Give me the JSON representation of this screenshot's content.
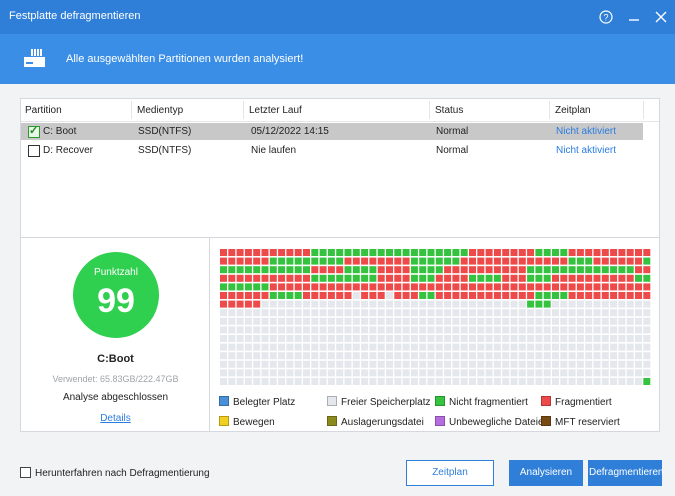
{
  "window": {
    "title": "Festplatte defragmentieren"
  },
  "banner": {
    "message": "Alle ausgewählten Partitionen wurden analysiert!"
  },
  "table": {
    "headers": [
      "Partition",
      "Medientyp",
      "Letzter Lauf",
      "Status",
      "Zeitplan"
    ],
    "rows": [
      {
        "checked": true,
        "partition": "C:  Boot",
        "media": "SSD(NTFS)",
        "last_run": "05/12/2022 14:15",
        "status": "Normal",
        "schedule": "Nicht aktiviert"
      },
      {
        "checked": false,
        "partition": "D:  Recover",
        "media": "SSD(NTFS)",
        "last_run": "Nie laufen",
        "status": "Normal",
        "schedule": "Nicht aktiviert"
      }
    ]
  },
  "score": {
    "label": "Punktzahl",
    "value": "99"
  },
  "partition_info": {
    "name": "C:Boot",
    "used": "Verwendet: 65.83GB/222.47GB",
    "status": "Analyse abgeschlossen",
    "details_link": "Details"
  },
  "legend": [
    {
      "label": "Belegter Platz",
      "color": "#4a90d9"
    },
    {
      "label": "Freier Speicherplatz",
      "color": "#e4e7ec"
    },
    {
      "label": "Nicht fragmentiert",
      "color": "#35c33f"
    },
    {
      "label": "Fragmentiert",
      "color": "#ee4a4a"
    },
    {
      "label": "Bewegen",
      "color": "#f1cf1e"
    },
    {
      "label": "Auslagerungsdatei",
      "color": "#8b8a1c"
    },
    {
      "label": "Unbewegliche Dateien",
      "color": "#b56ce0"
    },
    {
      "label": "MFT reserviert",
      "color": "#7a4a14"
    }
  ],
  "footer": {
    "shutdown_label": "Herunterfahren nach Defragmentierung",
    "schedule_button": "Zeitplan",
    "analyze_button": "Analysieren",
    "defrag_button": "Defragmentieren"
  },
  "block_map": {
    "colors": {
      "F": "#ee4a4a",
      "G": "#35c33f",
      "E": "#e4e7ec"
    },
    "rows": [
      "FFFFFFFFFFFGGGGGGGGGGGGGGGGGGGFFFFFFFFGGGGFFFFFFFFFF",
      "FFFFFFGGGGGGGGGFFFFFFFFGGGGGGFFFFFFFFFFFFFGGGFFFFFFG",
      "GGGGGGGGGGGFFFFGGGGFFFFGGGGFFFFFFFFFFGGGGGGGGGGGGGFF",
      "FFFFFFFFFFFGGGGGGGGFFFFGGGFFFFGGGGFFFGGGFFFFFFFFFFGG",
      "GGGGGGFFFFFFFFFFFFFFFFFFFFFFFFFFFFFFFFFFFFFFFFFFFFFF",
      "FFFFFFGGGGFFFFFFEFFFEFFFGGFFFFFFFFFFFFGGGGFFFFFFFFFF",
      "FFFFFEEEEEEEEEEEEEEEEEEEEEEEEEEEEEEEEGGGEEEEEEEEEEEE",
      "EEEEEEEEEEEEEEEEEEEEEEEEEEEEEEEEEEEEEEEEEEEEEEEEEEEE",
      "EEEEEEEEEEEEEEEEEEEEEEEEEEEEEEEEEEEEEEEEEEEEEEEEEEEE",
      "EEEEEEEEEEEEEEEEEEEEEEEEEEEEEEEEEEEEEEEEEEEEEEEEEEEE",
      "EEEEEEEEEEEEEEEEEEEEEEEEEEEEEEEEEEEEEEEEEEEEEEEEEEEE",
      "EEEEEEEEEEEEEEEEEEEEEEEEEEEEEEEEEEEEEEEEEEEEEEEEEEEE",
      "EEEEEEEEEEEEEEEEEEEEEEEEEEEEEEEEEEEEEEEEEEEEEEEEEEEE",
      "EEEEEEEEEEEEEEEEEEEEEEEEEEEEEEEEEEEEEEEEEEEEEEEEEEEE",
      "EEEEEEEEEEEEEEEEEEEEEEEEEEEEEEEEEEEEEEEEEEEEEEEEEEEE",
      "EEEEEEEEEEEEEEEEEEEEEEEEEEEEEEEEEEEEEEEEEEEEEEEEEEEG"
    ]
  }
}
